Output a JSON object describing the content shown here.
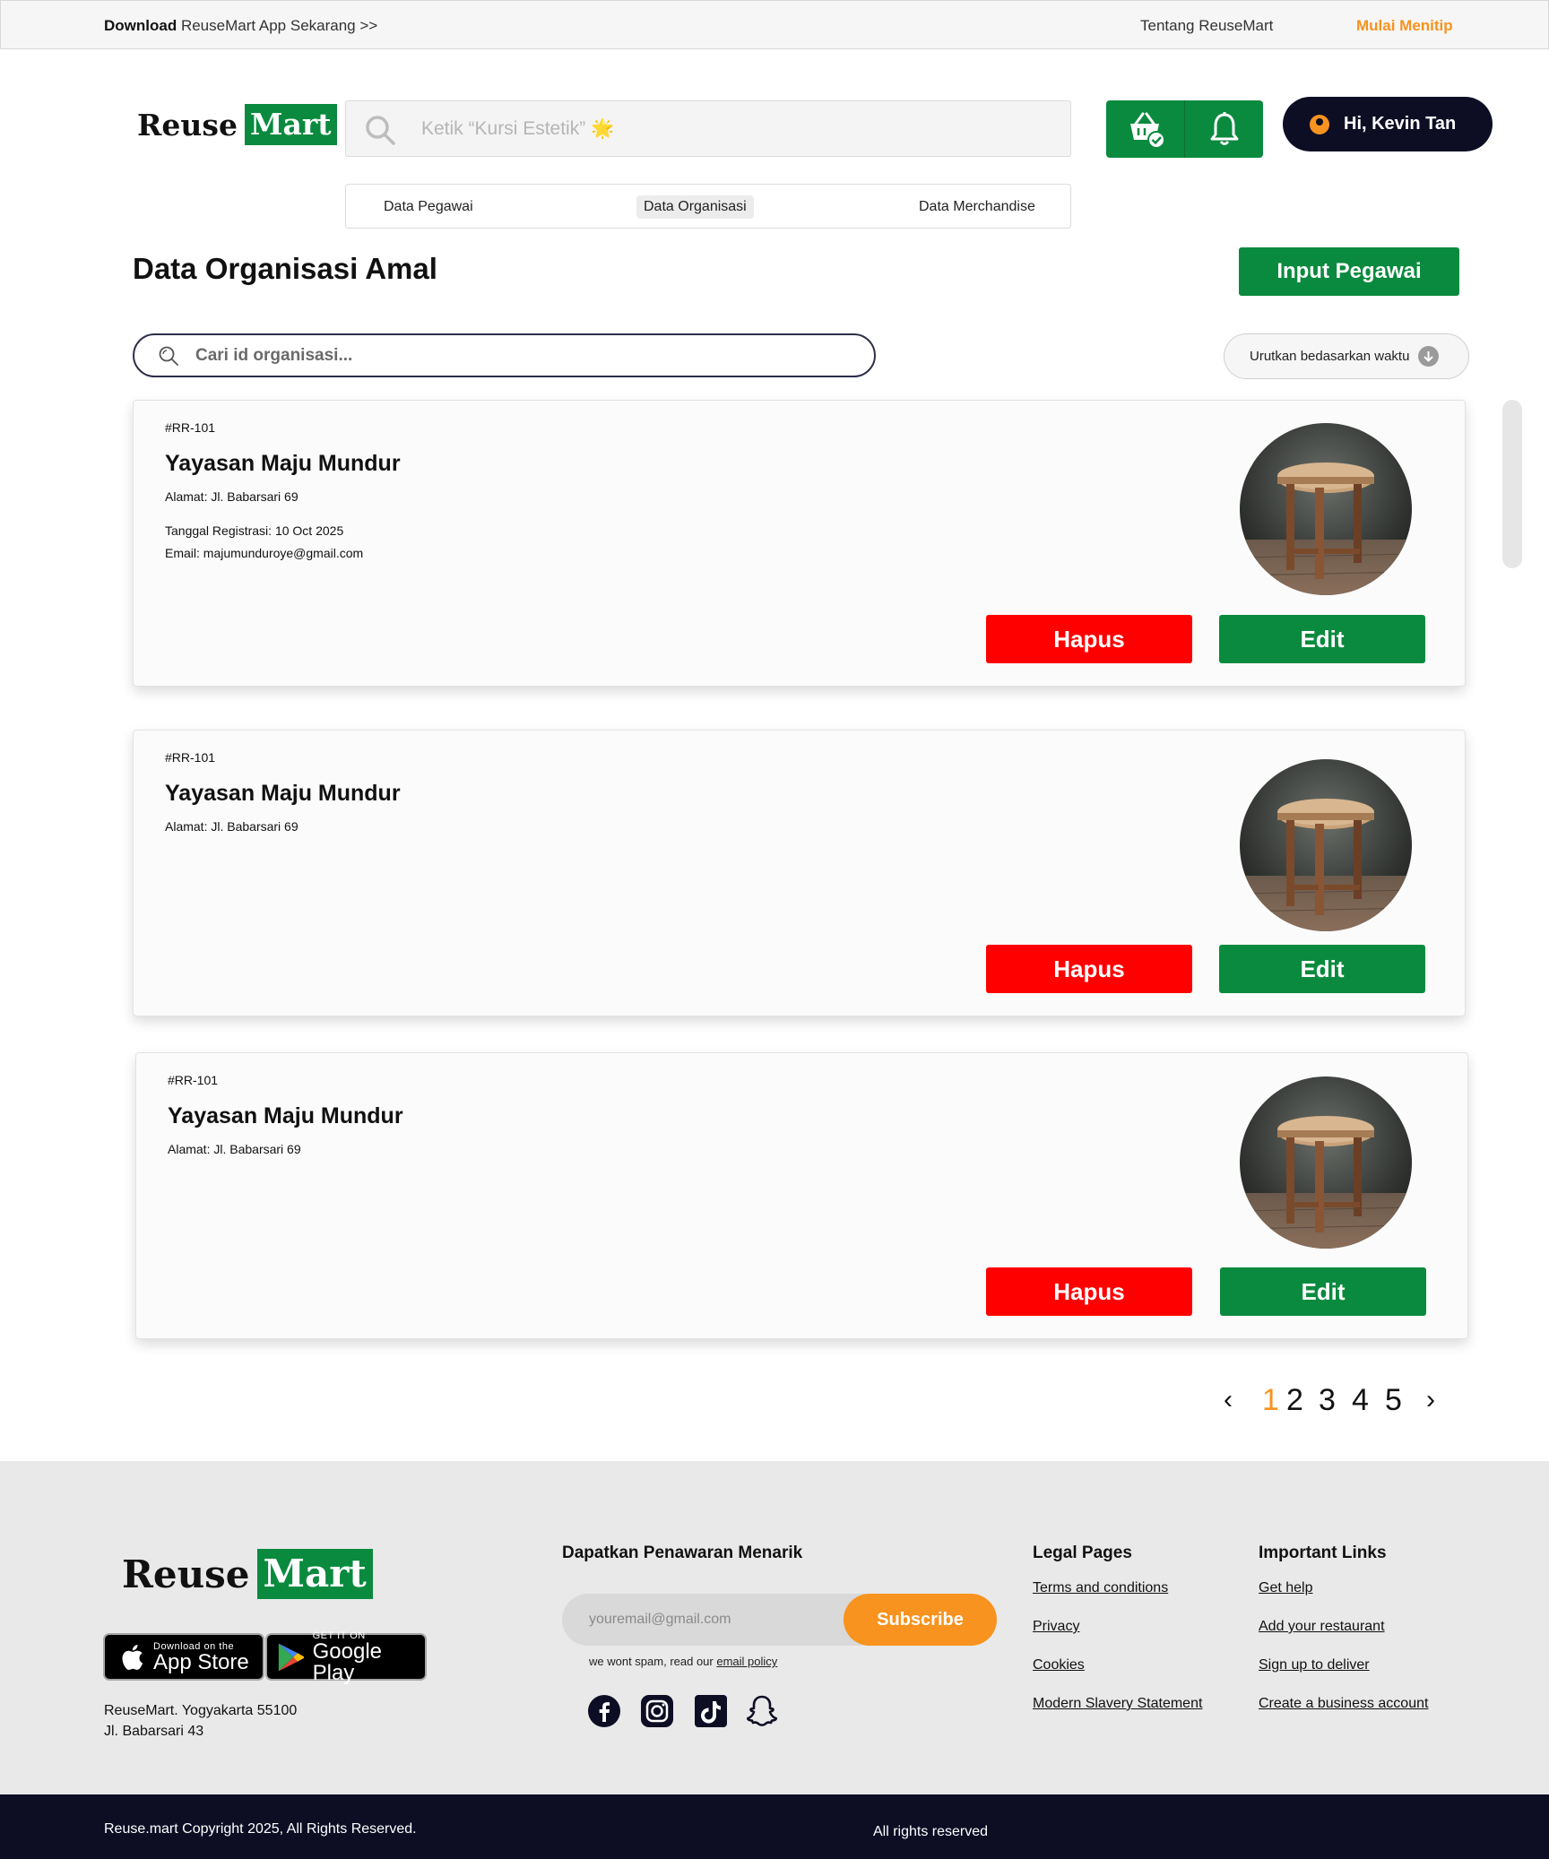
{
  "topbar": {
    "download_bold": "Download",
    "download_rest": "ReuseMart App Sekarang >>",
    "about": "Tentang ReuseMart",
    "consign": "Mulai Menitip"
  },
  "brand": {
    "reuse": "Reuse",
    "mart": "Mart"
  },
  "header": {
    "search_placeholder": "Ketik “Kursi Estetik” 🌟",
    "icons": [
      "basket-check-icon",
      "bell-icon"
    ],
    "user_greeting": "Hi, Kevin Tan"
  },
  "tabs": [
    {
      "label": "Data Pegawai",
      "active": false
    },
    {
      "label": "Data Organisasi",
      "active": true
    },
    {
      "label": "Data Merchandise",
      "active": false
    }
  ],
  "page": {
    "title": "Data Organisasi Amal",
    "input_button": "Input Pegawai",
    "search_placeholder": "Cari id organisasi...",
    "sort_label": "Urutkan bedasarkan waktu"
  },
  "cards": [
    {
      "id": "#RR-101",
      "name": "Yayasan Maju Mundur",
      "address": "Alamat: Jl. Babarsari 69",
      "registered": "Tanggal Registrasi: 10 Oct 2025",
      "email": "Email: majumunduroye@gmail.com",
      "delete_label": "Hapus",
      "edit_label": "Edit"
    },
    {
      "id": "#RR-101",
      "name": "Yayasan Maju Mundur",
      "address": "Alamat: Jl. Babarsari 69",
      "delete_label": "Hapus",
      "edit_label": "Edit"
    },
    {
      "id": "#RR-101",
      "name": "Yayasan Maju Mundur",
      "address": "Alamat: Jl. Babarsari 69",
      "delete_label": "Hapus",
      "edit_label": "Edit"
    }
  ],
  "pagination": {
    "prev": "‹",
    "pages": [
      "1",
      "2",
      "3",
      "4",
      "5"
    ],
    "current": "1",
    "next": "›"
  },
  "footer": {
    "app_store_small": "Download on the",
    "app_store_big": "App Store",
    "google_small": "GET IT ON",
    "google_big": "Google Play",
    "address_line1": "ReuseMart. Yogyakarta 55100",
    "address_line2": "Jl. Babarsari 43",
    "offer_title": "Dapatkan Penawaran Menarik",
    "email_placeholder": "youremail@gmail.com",
    "subscribe": "Subscribe",
    "spam_text": "we wont spam, read our",
    "spam_link": "email policy",
    "socials": [
      "facebook-icon",
      "instagram-icon",
      "tiktok-icon",
      "snapchat-icon"
    ],
    "legal_title": "Legal Pages",
    "legal_links": [
      "Terms and conditions",
      "Privacy",
      "Cookies",
      "Modern Slavery Statement"
    ],
    "important_title": "Important Links",
    "important_links": [
      "Get help",
      "Add your restaurant",
      "Sign up to deliver",
      "Create a business account"
    ],
    "copyright": "Reuse.mart Copyright 2025, All Rights Reserved.",
    "rights": "All rights reserved"
  },
  "colors": {
    "brand_green": "#0a8a3e",
    "accent_orange": "#f7931e",
    "danger_red": "#ff0000",
    "navy": "#0d0e24"
  }
}
